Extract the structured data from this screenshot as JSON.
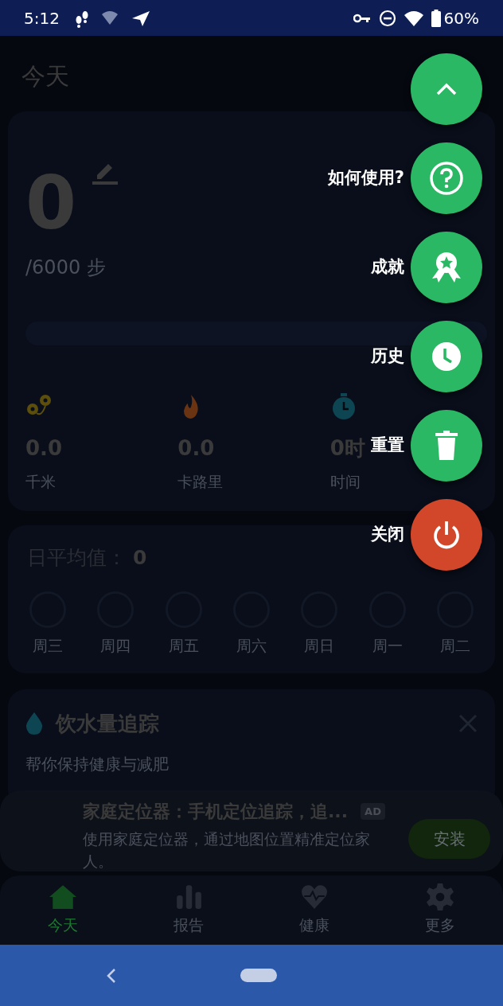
{
  "status_bar": {
    "time": "5:12",
    "battery": "60%"
  },
  "header": {
    "title": "今天"
  },
  "steps": {
    "count": "0",
    "goal": "/6000 步",
    "level": 0
  },
  "stats": [
    {
      "kind": "distance",
      "value": "0.0",
      "label": "千米"
    },
    {
      "kind": "calories",
      "value": "0.0",
      "label": "卡路里"
    },
    {
      "kind": "time",
      "value": "0时",
      "label": "时间"
    }
  ],
  "daily_average": {
    "label": "日平均值：",
    "value": "0",
    "days": [
      "周三",
      "周四",
      "周五",
      "周六",
      "周日",
      "周一",
      "周二"
    ]
  },
  "water_card": {
    "title": "饮水量追踪",
    "subtitle": "帮你保持健康与减肥"
  },
  "ad": {
    "title": "家庭定位器：手机定位追踪，追...",
    "badge": "AD",
    "description": "使用家庭定位器，通过地图位置精准定位家人。",
    "button": "安装"
  },
  "bottom_nav": [
    {
      "kind": "home",
      "label": "今天",
      "selected": true
    },
    {
      "kind": "report",
      "label": "报告",
      "selected": false
    },
    {
      "kind": "health",
      "label": "健康",
      "selected": false
    },
    {
      "kind": "more",
      "label": "更多",
      "selected": false
    }
  ],
  "fab_menu": {
    "expanded": true,
    "items": [
      {
        "kind": "help",
        "label": "如何使用?",
        "color": "#2bb865"
      },
      {
        "kind": "achievements",
        "label": "成就",
        "color": "#2bb865"
      },
      {
        "kind": "history",
        "label": "历史",
        "color": "#2bb865"
      },
      {
        "kind": "reset",
        "label": "重置",
        "color": "#2bb865"
      },
      {
        "kind": "power",
        "label": "关闭",
        "color": "#d2462a"
      }
    ]
  }
}
